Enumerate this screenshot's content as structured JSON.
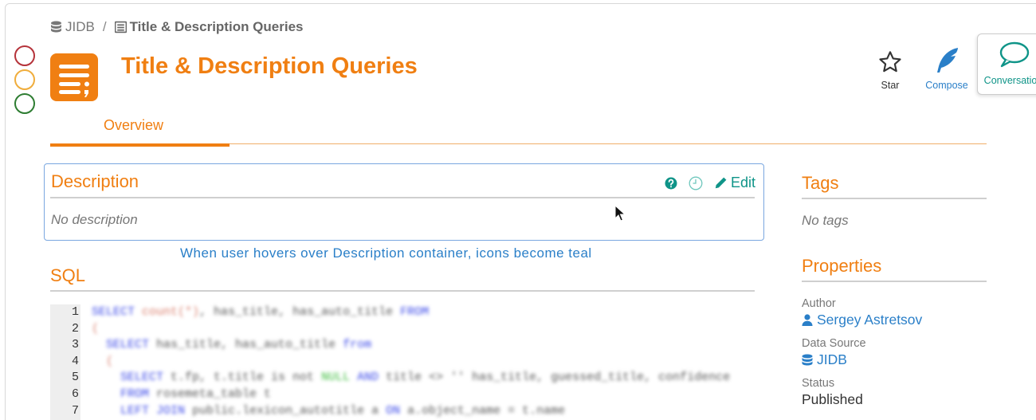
{
  "breadcrumb": {
    "root": "JIDB",
    "separator": "/",
    "current": "Title & Description Queries"
  },
  "header": {
    "title": "Title & Description Queries",
    "actions": {
      "star": "Star",
      "compose": "Compose",
      "conversation": "Conversation"
    }
  },
  "tabs": {
    "overview": "Overview"
  },
  "description": {
    "title": "Description",
    "empty_text": "No description",
    "edit_label": "Edit",
    "hover_note": "When user hovers over Description container, icons become teal"
  },
  "sql": {
    "title": "SQL",
    "lines": [
      {
        "n": "1",
        "code": "SELECT count(*), has_title, has_auto_title FROM"
      },
      {
        "n": "2",
        "code": "("
      },
      {
        "n": "3",
        "code": "  SELECT has_title, has_auto_title from"
      },
      {
        "n": "4",
        "code": "  ("
      },
      {
        "n": "5",
        "code": "    SELECT t.fp, t.title is not NULL AND title <> '' has_title, guessed_title, confidence"
      },
      {
        "n": "6",
        "code": "    FROM rosemeta_table t"
      },
      {
        "n": "7",
        "code": "    LEFT JOIN public.lexicon_autotitle a ON a.object_name = t.name"
      }
    ]
  },
  "tags": {
    "title": "Tags",
    "empty_text": "No tags"
  },
  "properties": {
    "title": "Properties",
    "author_label": "Author",
    "author_value": "Sergey Astretsov",
    "data_source_label": "Data Source",
    "data_source_value": "JIDB",
    "status_label": "Status",
    "status_value": "Published"
  },
  "colors": {
    "accent": "#f07f12",
    "teal": "#0f9488",
    "link": "#2a7fc8"
  }
}
